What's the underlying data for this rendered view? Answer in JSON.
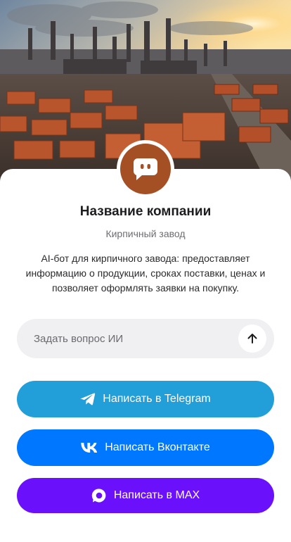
{
  "hero": {
    "alt": "brick-factory-image"
  },
  "company": {
    "name": "Название компании",
    "subtitle": "Кирпичный завод",
    "description": "AI-бот для кирпичного завода: предоставляет информацию о продукции, сроках поставки, ценах и позволяет оформлять заявки на покупку."
  },
  "ask": {
    "placeholder": "Задать вопрос ИИ",
    "value": ""
  },
  "buttons": {
    "telegram": {
      "label": "Написать в Telegram",
      "color": "#229ed9",
      "icon": "telegram-icon"
    },
    "vk": {
      "label": "Написать Вконтакте",
      "color": "#0077ff",
      "icon": "vk-icon"
    },
    "max": {
      "label": "Написать в MAX",
      "color": "#6b10fb",
      "icon": "max-icon"
    }
  },
  "colors": {
    "avatar": "#a44f24"
  }
}
